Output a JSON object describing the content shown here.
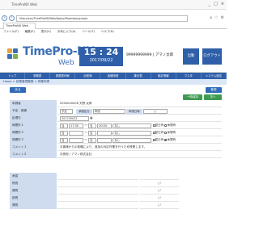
{
  "browser": {
    "url": "http://xxx/TimeProNX/Web/Apply/PaperApply.aspx",
    "tab_label": "TimeProNX Web",
    "menu": [
      "ファイル(F)",
      "編集(E)",
      "表示(V)",
      "お気に入り(A)",
      "ツール(T)",
      "ヘルプ(H)"
    ],
    "controls": [
      "_",
      "□",
      "×"
    ]
  },
  "header": {
    "logo_main": "TimePro-NX",
    "logo_sub": "Web",
    "clock_time": "15 : 24",
    "clock_date": "2017/09/22",
    "user_text": "99999999999 | アマノ太郎",
    "btn_left": "出勤",
    "btn_right": "ログアウト"
  },
  "nav": [
    "トップ",
    "勤務表",
    "勤務表印刷",
    "出勤簿",
    "各種申請",
    "集計表",
    "設定情報",
    "マスタ",
    "システム設定"
  ],
  "breadcrumb": "Home > 就業管理業務 > 残業申請",
  "toolbar": {
    "back": "戻る",
    "save": "登録",
    "draft": "一時保存",
    "next": "次へ"
  },
  "form": {
    "row1_label": "申請者",
    "row1_value": "0000000008  天野 太郎",
    "row2_label": "予定・実績",
    "row2_select": "予定",
    "row2_inline": "承認区分",
    "row2_status": "申請",
    "row2_date_label": "申請日時",
    "row2_date_value": "/ /",
    "row3_label": "処理日",
    "row3_value": "2017/09/22",
    "time_rows": [
      {
        "label": "時間外１",
        "from_day": "当",
        "from_time": "17:30",
        "to_day": "当",
        "to_time": "20:00",
        "kind": "なし",
        "chk1": "翌日有",
        "chk2": "休憩有"
      },
      {
        "label": "時間外２",
        "from_day": "当",
        "from_time": "",
        "to_day": "当",
        "to_time": "",
        "kind": "なし",
        "chk1": "翌日有",
        "chk2": "休憩有"
      },
      {
        "label": "時間外３",
        "from_day": "当",
        "from_time": "",
        "to_day": "当",
        "to_time": "",
        "kind": "なし",
        "chk1": "翌日有",
        "chk2": "休憩有"
      }
    ],
    "comment1_label": "コメント１",
    "comment1_value": "お客様からの依頼により、追加の対応作業を行うため残業します。",
    "comment2_label": "コメント２",
    "comment2_value": "次長宛 / アマノ株式会社"
  },
  "approval": {
    "header": "承認",
    "rows": [
      {
        "label": "係長",
        "date": "/ /"
      },
      {
        "label": "課長",
        "date": "/ /"
      },
      {
        "label": "部長",
        "date": "/ /"
      },
      {
        "label": "課長",
        "date": "/ /"
      }
    ]
  },
  "colors": {
    "brand": "#2f5fa8",
    "label_bg": "#cfdcef",
    "crumb_bg": "#dce7f5",
    "green": "#3f9a52"
  }
}
